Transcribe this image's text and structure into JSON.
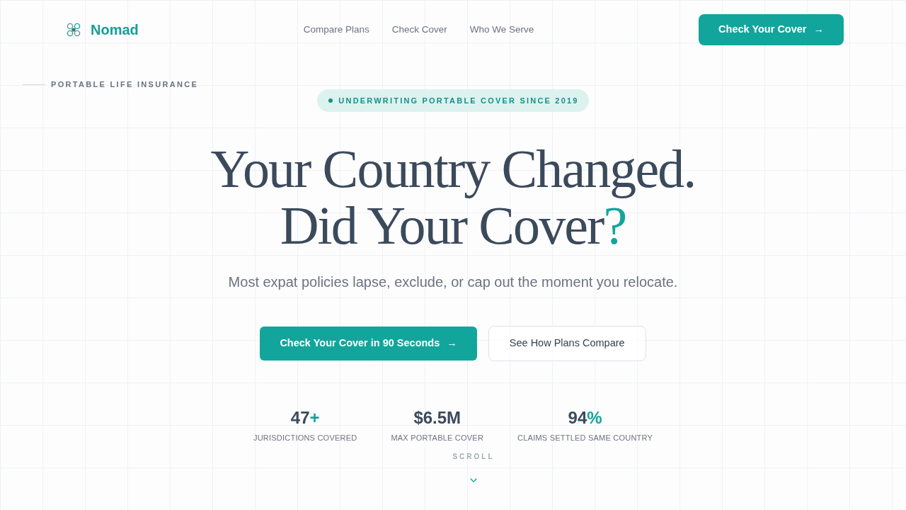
{
  "header": {
    "logo": {
      "name": "Nomad"
    },
    "nav": [
      {
        "label": "Compare Plans"
      },
      {
        "label": "Check Cover"
      },
      {
        "label": "Who We Serve"
      }
    ],
    "cta": {
      "label": "Check Your Cover",
      "arrow": "→"
    }
  },
  "hero": {
    "eyebrow": "PORTABLE LIFE INSURANCE",
    "badge": "UNDERWRITING PORTABLE COVER SINCE 2019",
    "headline": {
      "line_1": "Your Country Changed.",
      "line_2": "Did Your Cover",
      "accent": "?"
    },
    "subheadline": "Most expat policies lapse, exclude, or cap out the moment you relocate.",
    "buttons": [
      {
        "kind": "primary",
        "label": "Check Your Cover in 90 Seconds",
        "arrow": "→"
      },
      {
        "kind": "secondary",
        "label": "See How Plans Compare"
      }
    ],
    "stats": [
      {
        "value": "47",
        "accent": "+",
        "label": "JURISDICTIONS COVERED"
      },
      {
        "value": "$6.5M",
        "label": "MAX PORTABLE COVER"
      },
      {
        "value": "94",
        "accent": "%",
        "label": "CLAIMS SETTLED SAME COUNTRY"
      }
    ],
    "scroll": {
      "label": "SCROLL"
    }
  }
}
